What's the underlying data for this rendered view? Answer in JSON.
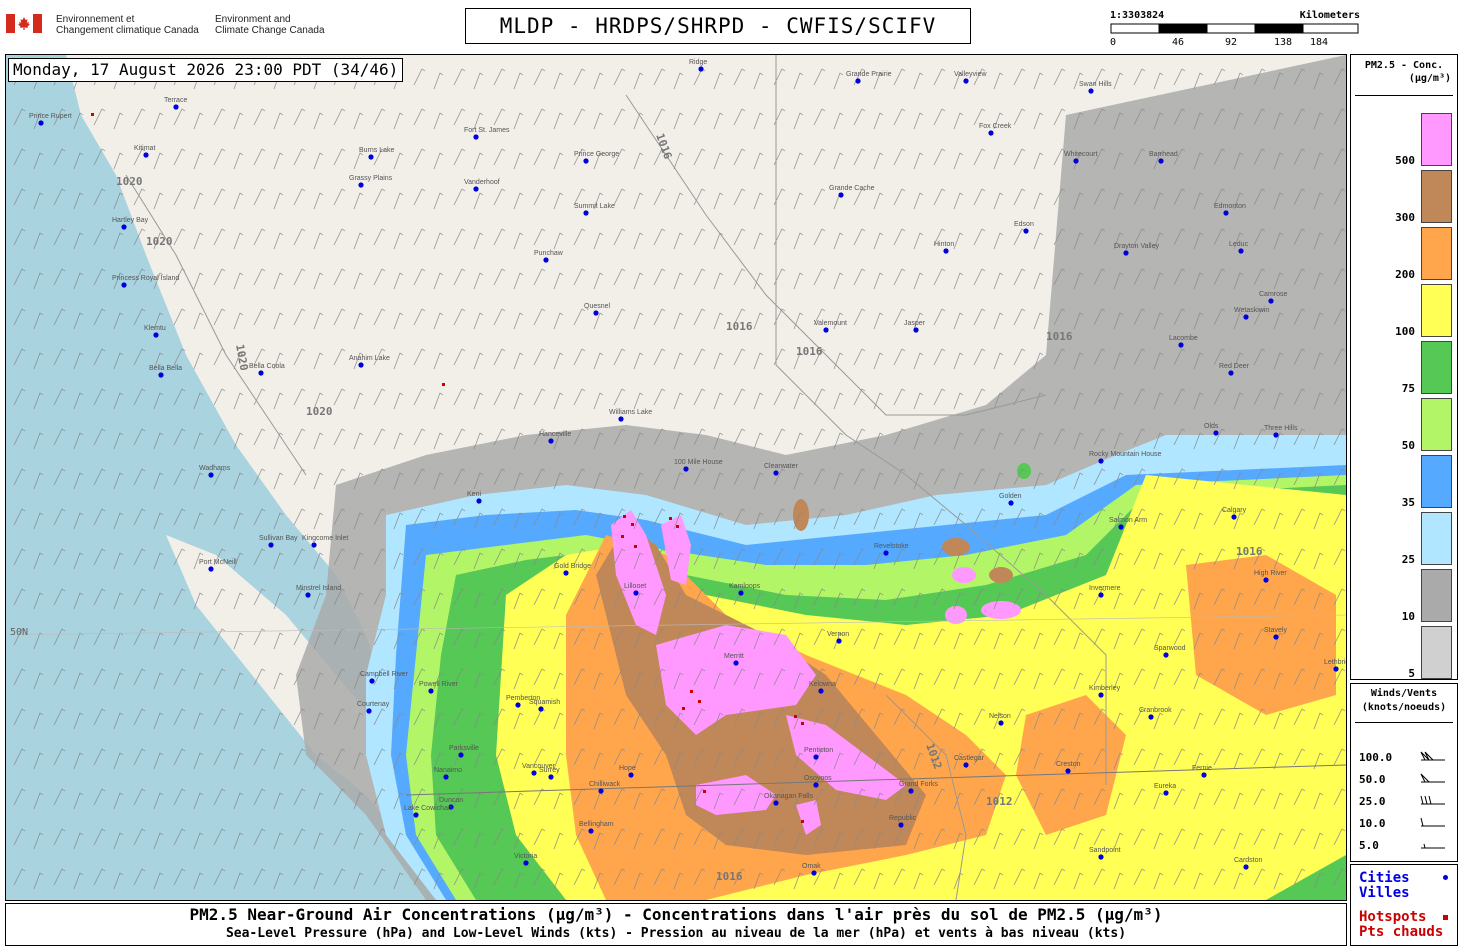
{
  "header": {
    "agency_fr_line1": "Environnement et",
    "agency_fr_line2": "Changement climatique Canada",
    "agency_en_line1": "Environment and",
    "agency_en_line2": "Climate Change Canada",
    "title": "MLDP - HRDPS/SHRPD - CWFIS/SCIFV"
  },
  "scale_bar": {
    "ratio": "1:3303824",
    "unit": "Kilometers",
    "ticks": [
      "0",
      "46",
      "92",
      "138",
      "184"
    ]
  },
  "timestamp": "Monday, 17 August 2026 23:00 PDT (34/46)",
  "legend": {
    "title_line1": "PM2.5 - Conc.",
    "title_line2": "(µg/m³)",
    "bins": [
      {
        "label": "500",
        "color": "#ff99ff"
      },
      {
        "label": "300",
        "color": "#c08858"
      },
      {
        "label": "200",
        "color": "#ffa64d"
      },
      {
        "label": "100",
        "color": "#ffff55"
      },
      {
        "label": "75",
        "color": "#55c855"
      },
      {
        "label": "50",
        "color": "#b2f566"
      },
      {
        "label": "35",
        "color": "#55aaff"
      },
      {
        "label": "25",
        "color": "#b0e6ff"
      },
      {
        "label": "10",
        "color": "#aaaaaa"
      },
      {
        "label": "5",
        "color": "#d0d0d0"
      }
    ]
  },
  "winds_legend": {
    "title_line1": "Winds/Vents",
    "title_line2": "(knots/noeuds)",
    "rows": [
      "100.0",
      "50.0",
      "25.0",
      "10.0",
      "5.0"
    ]
  },
  "points_legend": {
    "cities_en": "Cities",
    "cities_fr": "Villes",
    "hotspots_en": "Hotspots",
    "hotspots_fr": "Pts chauds",
    "city_color": "#0000dd",
    "hotspot_color": "#dd0000"
  },
  "footer": {
    "line1": "PM2.5 Near-Ground Air Concentrations (µg/m³) - Concentrations dans l'air près du sol de PM2.5 (µg/m³)",
    "line2": "Sea-Level Pressure (hPa) and Low-Level Winds (kts) - Pression au niveau de la mer (hPa) et vents à bas niveau (kts)"
  },
  "map": {
    "cities": [
      "Prince Rupert",
      "Terrace",
      "Kitimat",
      "Hartley Bay",
      "Princess Royal Island",
      "Klemtu",
      "Bella Bella",
      "Bella Coola",
      "Anahim Lake",
      "Hanceville",
      "Williams Lake",
      "100 Mile House",
      "Clearwater",
      "Quesnel",
      "Prince George",
      "Vanderhoof",
      "Fort St. James",
      "Burns Lake",
      "Grassy Plains",
      "Punchaw",
      "Summit Lake",
      "Valemount",
      "Jasper",
      "Hinton",
      "Edson",
      "Grande Cache",
      "Fox Creek",
      "Swan Hills",
      "Whitecourt",
      "Barrhead",
      "Edmonton",
      "Leduc",
      "Drayton Valley",
      "Red Deer",
      "Olds",
      "Calgary",
      "Golden",
      "Revelstoke",
      "Salmon Arm",
      "Kamloops",
      "Lillooet",
      "Gold Bridge",
      "Merritt",
      "Kelowna",
      "Vernon",
      "Penticton",
      "Osoyoos",
      "Grand Forks",
      "Castlegar",
      "Nelson",
      "Cranbrook",
      "Kimberley",
      "Invermere",
      "Creston",
      "Fernie",
      "Sparwood",
      "Squamish",
      "Pemberton",
      "Vancouver",
      "Surrey",
      "Chilliwack",
      "Hope",
      "Powell River",
      "Campbell River",
      "Courtenay",
      "Parksville",
      "Nanaimo",
      "Duncan",
      "Lake Cowichan",
      "Victoria",
      "Port McNeill",
      "Sullivan Bay",
      "Kingcome Inlet",
      "Minstrel Island",
      "Wadhams",
      "Keni",
      "Bellingham",
      "Okanagan Falls",
      "Republic",
      "Omak",
      "Cardston",
      "Lethbridge",
      "Stavely",
      "High River",
      "Eureka",
      "Sandpoint",
      "Rocky Mountain House",
      "Three Hills",
      "Camrose",
      "Wetaskiwin",
      "Lacombe",
      "Valleyview",
      "Grande Prairie",
      "Ridge"
    ],
    "isobar_labels": [
      "1020",
      "1016",
      "1012"
    ],
    "latitude_label": "50N"
  }
}
